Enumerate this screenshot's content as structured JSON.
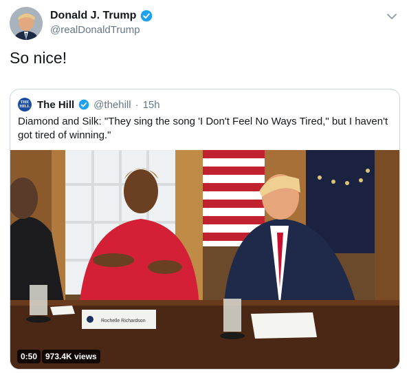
{
  "tweet": {
    "display_name": "Donald J. Trump",
    "handle": "@realDonaldTrump",
    "text": "So nice!",
    "avatar_icon": "profile-photo",
    "verified_icon": "verified-badge-icon",
    "menu_icon": "chevron-down-icon"
  },
  "quote": {
    "avatar_text": "THE HILL",
    "display_name": "The Hill",
    "handle": "@thehill",
    "separator": "·",
    "time": "15h",
    "text": "Diamond and Silk: \"They sing the song 'I Don't Feel No Ways Tired,\" but I haven't got tired of winning.\""
  },
  "video": {
    "duration": "0:50",
    "views": "973.4K views",
    "nameplate": "Rochelle Richardson"
  },
  "colors": {
    "verified": "#1da1f2",
    "secondary_text": "#657786",
    "border": "#ccd6dd",
    "hill_blue": "#1a4da1"
  }
}
